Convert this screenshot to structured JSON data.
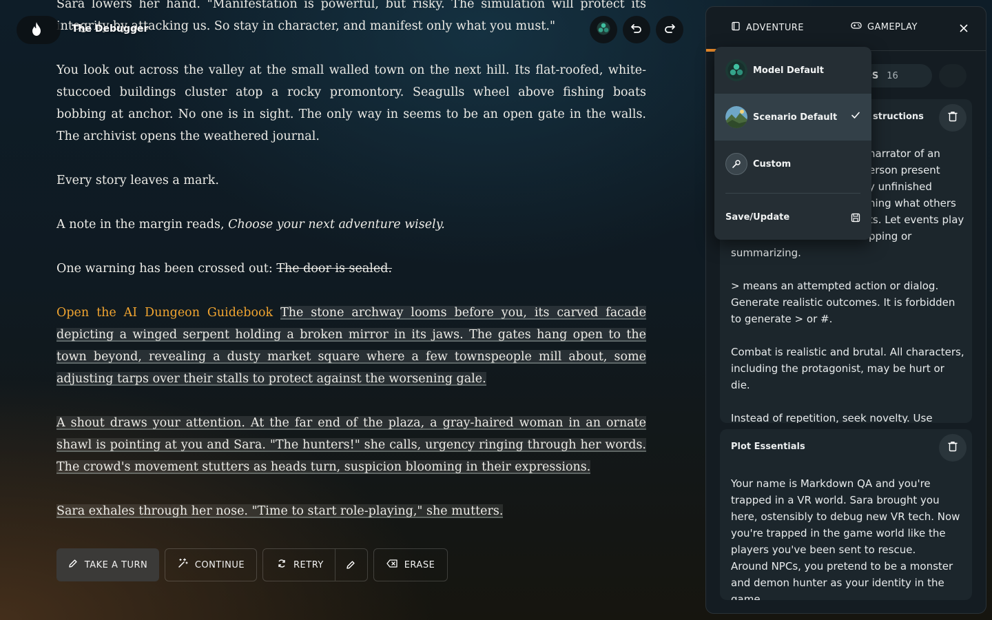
{
  "header": {
    "title": "The Debugger",
    "icons": [
      "flame-icon",
      "model-avatar-icon",
      "undo-icon",
      "redo-icon"
    ]
  },
  "story": {
    "p1": "Sara lowers her hand. \"Manifestation is powerful, but risky. The simulation will protect its integrity by attacking us. So stay in character, and manifest only what you must.\"",
    "p2": "You look out across the valley at the small walled town on the next hill. Its flat-roofed, white-stuccoed buildings cluster atop a rocky promontory. Seagulls wheel above fishing boats bobbing at anchor. No one is in sight. The only way in seems to be an open gate in the walls. The archivist opens the weathered journal.",
    "p3": "Every story leaves a mark.",
    "p4_prefix": "A note in the margin reads, ",
    "p4_italic": "Choose your next adventure wisely.",
    "p5_prefix": "One warning has been crossed out: ",
    "p5_strike": "The door is sealed.",
    "guidebook_link": "Open the AI Dungeon Guidebook",
    "p6": "The stone archway looms before you, its carved facade depicting a winged serpent holding a broken mirror in its jaws. The gates hang open to the town beyond, revealing a dusty market square where a few townspeople mill about, some adjusting tarps over their stalls to protect against the worsening gale.",
    "p7": "A shout draws your attention. At the far end of the plaza, a gray-haired woman in an ornate shawl is pointing at you and Sara. \"The hunters!\" she calls, urgency ringing through her words. The crowd's movement stutters as heads turn, suspicion blooming in their expressions.",
    "p8": "Sara exhales through her nose. \"Time to start role-playing,\" she mutters."
  },
  "actions": {
    "take_turn": "TAKE A TURN",
    "continue": "CONTINUE",
    "retry": "RETRY",
    "erase": "ERASE"
  },
  "panel": {
    "tabs": {
      "adventure": "ADVENTURE",
      "gameplay": "GAMEPLAY"
    },
    "active_tab": "adventure",
    "accent": "#e98a2a",
    "pill_cards_label": "ARDS",
    "pill_cards_count": "16",
    "card1_title_partial": "structions",
    "card1_right_fragments": [
      "narrator of an",
      "erson present",
      "y unfinished",
      "hing what others",
      "ts. Let events play",
      "pping or"
    ],
    "card1_body": "summarizing.\n\n> means an attempted action or dialog. Generate realistic outcomes. It is forbidden to generate > or #.\n\nCombat is realistic and brutal. All characters, including the protagonist, may be hurt or die.\n\nInstead of repetition, seek novelty. Use everyday words, but be specific and creative.",
    "card2_title": "Plot Essentials",
    "card2_body": "Your name is Markdown QA and you're trapped in a VR world. Sara brought you here, ostensibly to debug new VR tech. Now you're trapped in the game world like the players you've been sent to rescue.\nAround NPCs, you pretend to be a monster and demon hunter as your identity in the game."
  },
  "dropdown": {
    "options": [
      {
        "label": "Model Default",
        "icon": "model-default-icon"
      },
      {
        "label": "Scenario Default",
        "icon": "scenario-landscape-icon",
        "selected": true
      },
      {
        "label": "Custom",
        "icon": "wrench-icon"
      }
    ],
    "save_label": "Save/Update"
  }
}
